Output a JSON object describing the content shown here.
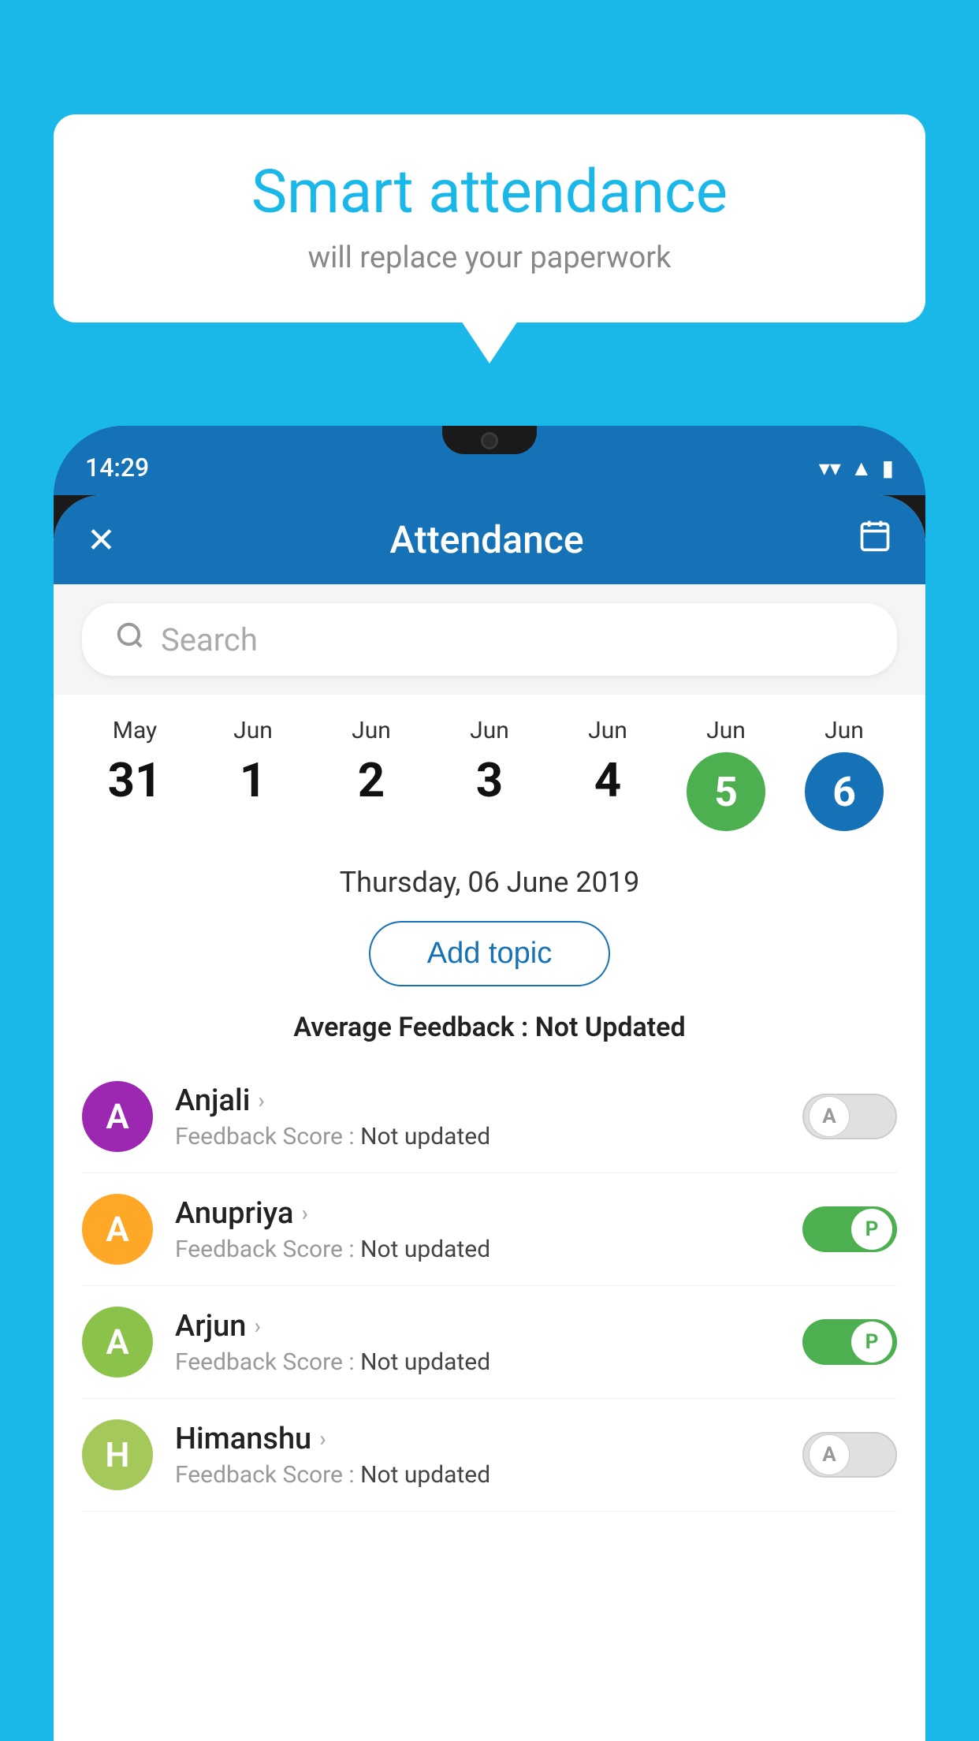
{
  "background_color": "#1ab8e8",
  "speech_bubble": {
    "title": "Smart attendance",
    "subtitle": "will replace your paperwork"
  },
  "phone": {
    "status_bar": {
      "time": "14:29",
      "wifi": "▼",
      "signal": "▲",
      "battery": "▮"
    },
    "header": {
      "title": "Attendance",
      "close_label": "✕",
      "calendar_label": "📅"
    },
    "search": {
      "placeholder": "Search"
    },
    "calendar": {
      "days": [
        {
          "month": "May",
          "date": "31",
          "style": "normal"
        },
        {
          "month": "Jun",
          "date": "1",
          "style": "normal"
        },
        {
          "month": "Jun",
          "date": "2",
          "style": "normal"
        },
        {
          "month": "Jun",
          "date": "3",
          "style": "normal"
        },
        {
          "month": "Jun",
          "date": "4",
          "style": "normal"
        },
        {
          "month": "Jun",
          "date": "5",
          "style": "green"
        },
        {
          "month": "Jun",
          "date": "6",
          "style": "blue"
        }
      ]
    },
    "selected_date": "Thursday, 06 June 2019",
    "add_topic_label": "Add topic",
    "average_feedback": {
      "label": "Average Feedback : ",
      "value": "Not Updated"
    },
    "students": [
      {
        "name": "Anjali",
        "avatar_letter": "A",
        "avatar_color": "#9c27b0",
        "feedback_label": "Feedback Score : ",
        "feedback_value": "Not updated",
        "status": "absent"
      },
      {
        "name": "Anupriya",
        "avatar_letter": "A",
        "avatar_color": "#ffa726",
        "feedback_label": "Feedback Score : ",
        "feedback_value": "Not updated",
        "status": "present"
      },
      {
        "name": "Arjun",
        "avatar_letter": "A",
        "avatar_color": "#8bc34a",
        "feedback_label": "Feedback Score : ",
        "feedback_value": "Not updated",
        "status": "present"
      },
      {
        "name": "Himanshu",
        "avatar_letter": "H",
        "avatar_color": "#a5c85a",
        "feedback_label": "Feedback Score : ",
        "feedback_value": "Not updated",
        "status": "absent"
      }
    ]
  }
}
